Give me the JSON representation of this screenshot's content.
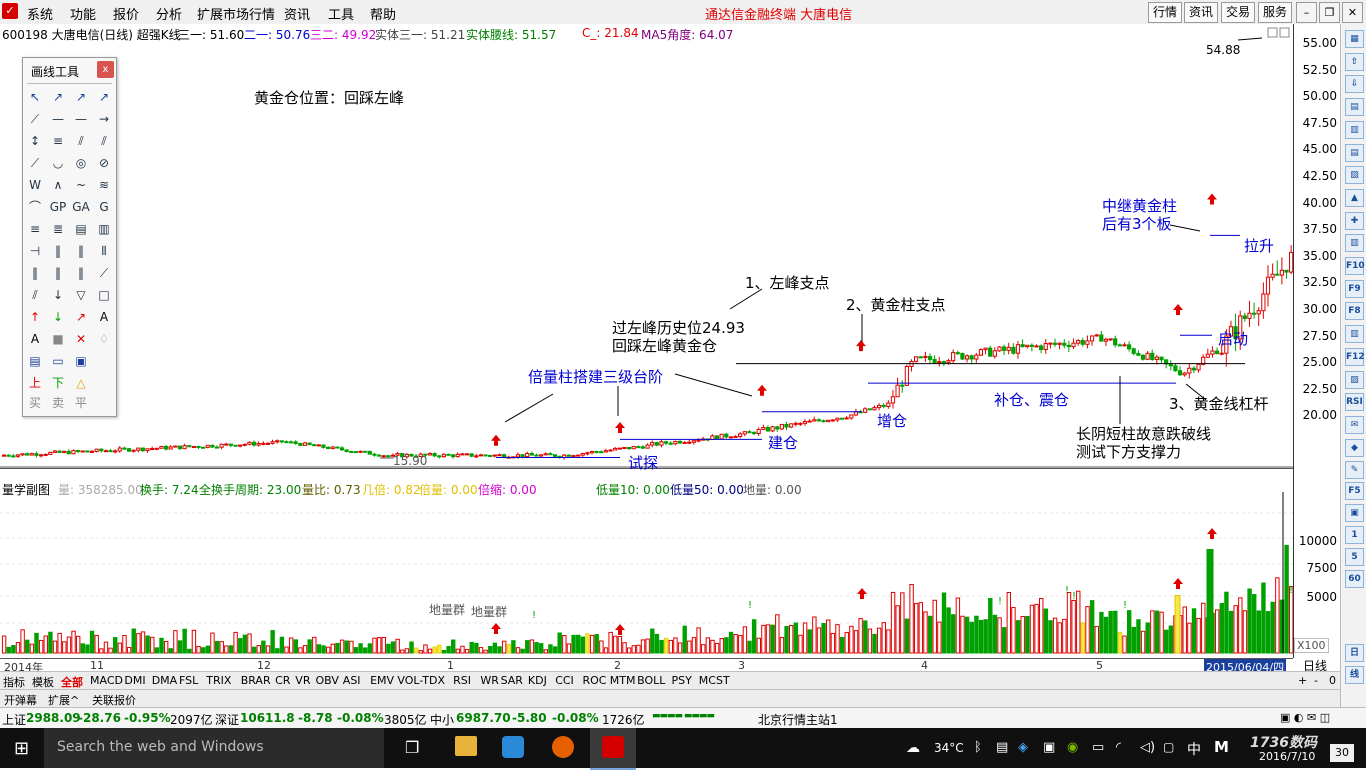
{
  "menu": {
    "items": [
      "系统",
      "功能",
      "报价",
      "分析",
      "扩展市场行情",
      "资讯",
      "工具",
      "帮助"
    ],
    "center_title": "通达信金融终端   大唐电信",
    "right_buttons": [
      "行情",
      "资讯",
      "交易",
      "服务"
    ]
  },
  "chart_header": {
    "symbol": "600198 大唐电信(日线) 超强K线",
    "l1": "三一: 51.60",
    "l2": "二一: 50.76",
    "l3": "三二: 49.92",
    "l4": "实体三一: 51.21",
    "l5": "实体腰线: 51.57",
    "l6": "C_: 21.84",
    "l7": "MA5角度: 64.07"
  },
  "y_axis_main": [
    "55.00",
    "52.50",
    "50.00",
    "47.50",
    "45.00",
    "42.50",
    "40.00",
    "37.50",
    "35.00",
    "32.50",
    "30.00",
    "27.50",
    "25.00",
    "22.50",
    "20.00"
  ],
  "y_axis_sub": [
    "10000",
    "7500",
    "5000"
  ],
  "sub_header": {
    "title": "量学副图",
    "l1": "量: 358285.00",
    "l2": "换手: 7.24",
    "l3": "全换手周期: 23.00",
    "l4": "量比: 0.73",
    "l5": "几倍: 0.82",
    "l6": "倍量: 0.00",
    "l7": "倍缩: 0.00",
    "l8": "低量10: 0.00",
    "l9": "低量50: 0.00",
    "l10": "地量: 0.00"
  },
  "sub_chart_right": {
    "x100": "X100",
    "a": "1",
    "b": "5",
    "c": "60"
  },
  "palette": {
    "title": "画线工具",
    "close": "x",
    "bottom": [
      "买",
      "卖",
      "平"
    ]
  },
  "annotations": {
    "golden_pos": "黄金仓位置：回踩左峰",
    "peak_left": "1、左峰支点",
    "over_left": "过左峰历史位24.93",
    "back_left": "回踩左峰黄金仓",
    "golden_pillar": "2、黄金柱支点",
    "relay1": "中继黄金柱",
    "relay2": "后有3个板",
    "lift": "拉升",
    "start": "启动",
    "level3": "3、黄金线杠杆",
    "triple": "倍量柱搭建三级台阶",
    "addpos": "增仓",
    "buildpos": "建仓",
    "probe": "试探",
    "supplement": "补仓、震仓",
    "long_neg": "长阴短柱故意跌破线",
    "test_below": "测试下方支撑力",
    "low_price": "15.90",
    "high_price": "54.88",
    "vol_ground1": "地量群",
    "vol_ground2": "地量群"
  },
  "date_axis": {
    "labels": [
      "2014年",
      "11",
      "12",
      "1",
      "2",
      "3",
      "4",
      "5"
    ],
    "cursor_date": "2015/06/04/四",
    "period": "日线"
  },
  "indicator_tabs": [
    "指标",
    "模板",
    "全部",
    "MACD",
    "DMI",
    "DMA",
    "FSL",
    "TRIX",
    "BRAR",
    "CR",
    "VR",
    "OBV",
    "ASI",
    "EMV",
    "VOL-TDX",
    "RSI",
    "WR",
    "SAR",
    "KDJ",
    "CCI",
    "ROC",
    "MTM",
    "BOLL",
    "PSY",
    "MCST"
  ],
  "indicator_right": {
    "plus": "+",
    "minus": "-",
    "zero": "0"
  },
  "bottom_tabs": [
    "开弹幕",
    "扩展^",
    "关联报价"
  ],
  "status": {
    "sh_name": "上证",
    "sh_val": "2988.09",
    "sh_chg": "-28.76",
    "sh_pct": "-0.95%",
    "sh_amt": "2097亿",
    "sz_name": "深证",
    "sz_val": "10611.8",
    "sz_chg": "-8.78",
    "sz_pct": "-0.08%",
    "sz_amt": "3805亿",
    "zx_name": "中小",
    "zx_val": "6987.70",
    "zx_chg": "-5.80",
    "zx_pct": "-0.08%",
    "zx_amt": "1726亿",
    "server": "北京行情主站1"
  },
  "taskbar": {
    "search": "Search the web and Windows",
    "weather": "34°C",
    "ime": "中",
    "ime2": "M",
    "date": "2016/7/10",
    "watermark": "1736数码",
    "badge": "30"
  },
  "colors": {
    "up": "#e00000",
    "down": "#00a000",
    "blue": "#0000d0",
    "yellow": "#e8d000",
    "magenta": "#d000d0"
  }
}
